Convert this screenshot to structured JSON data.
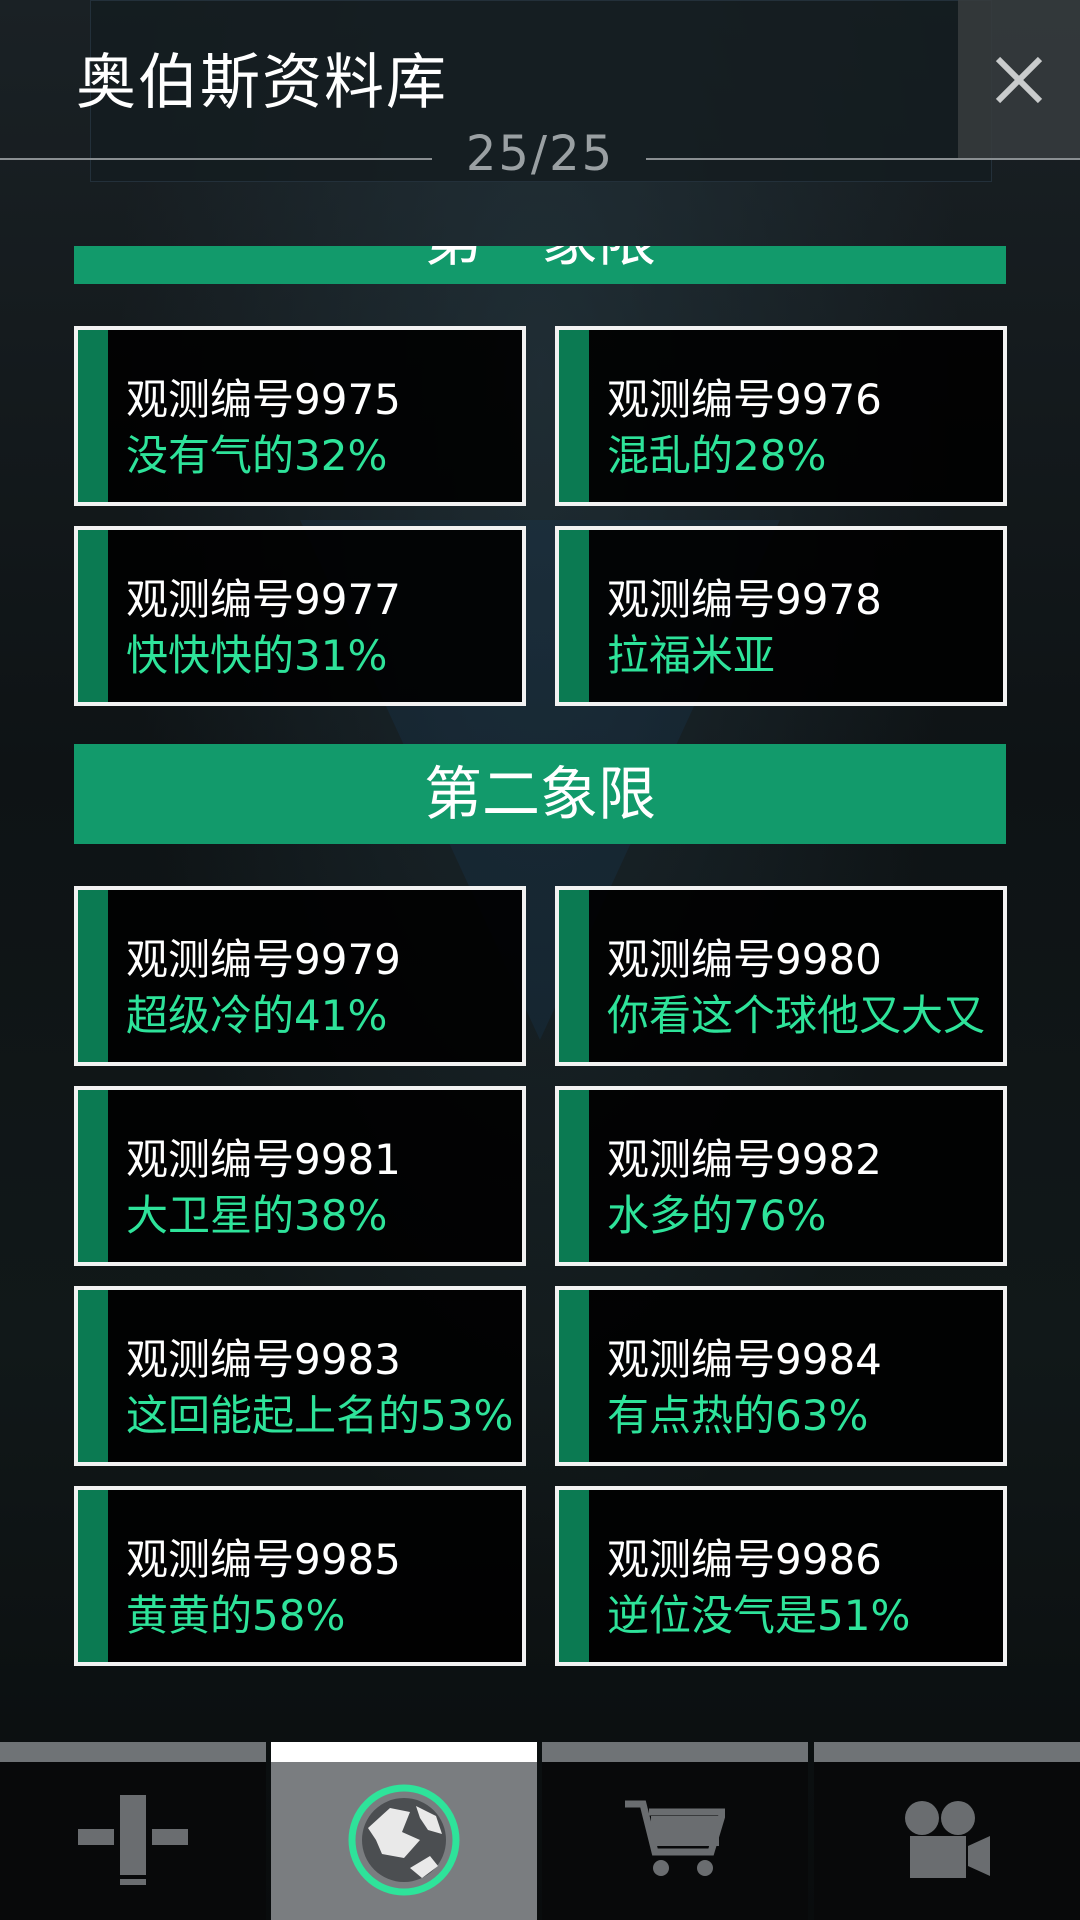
{
  "header": {
    "title": "奥伯斯资料库",
    "counter": "25/25"
  },
  "sections": {
    "partial_title": "第一象限",
    "second_title": "第二象限"
  },
  "cards": [
    {
      "id": "观测编号9975",
      "desc": "没有气的32%"
    },
    {
      "id": "观测编号9976",
      "desc": "混乱的28%"
    },
    {
      "id": "观测编号9977",
      "desc": "快快快的31%"
    },
    {
      "id": "观测编号9978",
      "desc": "拉福米亚"
    },
    {
      "id": "观测编号9979",
      "desc": "超级冷的41%"
    },
    {
      "id": "观测编号9980",
      "desc": "你看这个球他又大又"
    },
    {
      "id": "观测编号9981",
      "desc": "大卫星的38%"
    },
    {
      "id": "观测编号9982",
      "desc": "水多的76%"
    },
    {
      "id": "观测编号9983",
      "desc": "这回能起上名的53%"
    },
    {
      "id": "观测编号9984",
      "desc": "有点热的63%"
    },
    {
      "id": "观测编号9985",
      "desc": "黄黄的58%"
    },
    {
      "id": "观测编号9986",
      "desc": "逆位没气是51%"
    }
  ],
  "nav": {
    "tabs": [
      {
        "icon": "dashboard-icon",
        "active": false
      },
      {
        "icon": "planet-icon",
        "active": true
      },
      {
        "icon": "cart-icon",
        "active": false
      },
      {
        "icon": "video-camera-icon",
        "active": false
      }
    ]
  },
  "colors": {
    "accent": "#129a6b",
    "accent_dark": "#0b7a52",
    "desc_text": "#2ee39a",
    "ring": "#2ee39a"
  }
}
